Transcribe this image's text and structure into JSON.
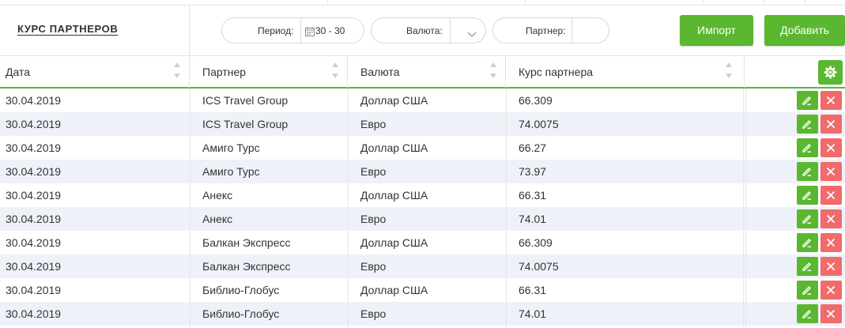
{
  "page": {
    "title": "КУРС ПАРТНЕРОВ"
  },
  "filters": {
    "period": {
      "label": "Период:",
      "value": "30 - 30",
      "icon": "calendar-icon"
    },
    "currency": {
      "label": "Валюта:",
      "value": "",
      "icon": "chevron-down-icon"
    },
    "partner": {
      "label": "Партнер:",
      "value": ""
    }
  },
  "toolbar": {
    "import_label": "Импорт",
    "add_label": "Добавить"
  },
  "table": {
    "columns": [
      "Дата",
      "Партнер",
      "Валюта",
      "Курс партнера"
    ],
    "rows": [
      {
        "date": "30.04.2019",
        "partner": "ICS Travel Group",
        "currency": "Доллар США",
        "rate": "66.309"
      },
      {
        "date": "30.04.2019",
        "partner": "ICS Travel Group",
        "currency": "Евро",
        "rate": "74.0075"
      },
      {
        "date": "30.04.2019",
        "partner": "Амиго Турс",
        "currency": "Доллар США",
        "rate": "66.27"
      },
      {
        "date": "30.04.2019",
        "partner": "Амиго Турс",
        "currency": "Евро",
        "rate": "73.97"
      },
      {
        "date": "30.04.2019",
        "partner": "Анекс",
        "currency": "Доллар США",
        "rate": "66.31"
      },
      {
        "date": "30.04.2019",
        "partner": "Анекс",
        "currency": "Евро",
        "rate": "74.01"
      },
      {
        "date": "30.04.2019",
        "partner": "Балкан Экспресс",
        "currency": "Доллар США",
        "rate": "66.309"
      },
      {
        "date": "30.04.2019",
        "partner": "Балкан Экспресс",
        "currency": "Евро",
        "rate": "74.0075"
      },
      {
        "date": "30.04.2019",
        "partner": "Библио-Глобус",
        "currency": "Доллар США",
        "rate": "66.31"
      },
      {
        "date": "30.04.2019",
        "partner": "Библио-Глобус",
        "currency": "Евро",
        "rate": "74.01"
      }
    ]
  },
  "icons": {
    "settings": "gear-icon",
    "edit": "pencil-icon",
    "delete": "close-icon",
    "sort": "sort-arrows-icon"
  },
  "colors": {
    "accent_green": "#5ab72f",
    "delete_red": "#f06b6b",
    "row_alt": "#eef1f8"
  }
}
